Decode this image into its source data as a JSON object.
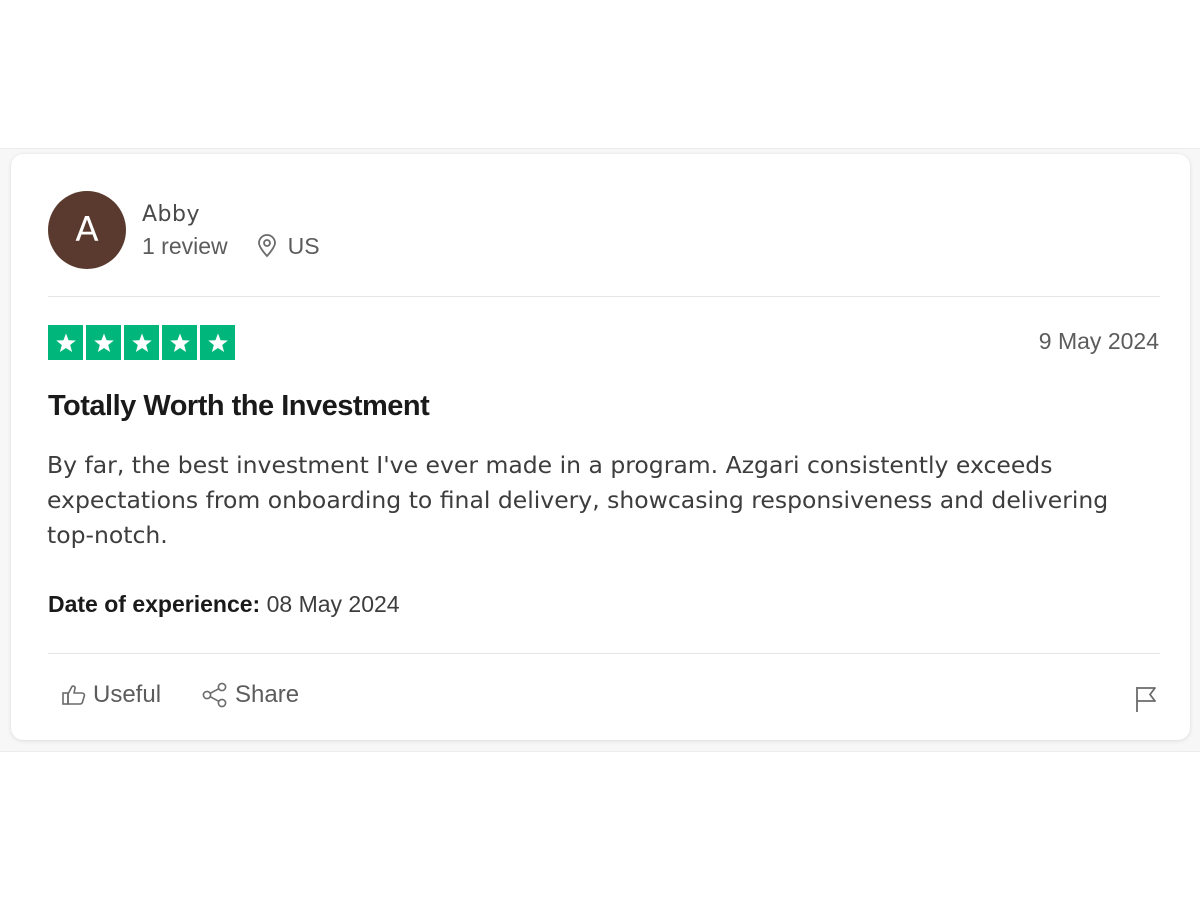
{
  "colors": {
    "avatar_bg": "#5a3a2e",
    "star_green": "#00b67a",
    "star_white": "#ffffff"
  },
  "reviewer": {
    "initial": "A",
    "name": "Abby",
    "review_count": "1 review",
    "location_icon": "location-pin-icon",
    "country": "US"
  },
  "review": {
    "rating": 5,
    "rating_max": 5,
    "date": "9 May 2024",
    "title": "Totally Worth the Investment",
    "body": "By far, the best investment I've ever made in a program. Azgari consistently exceeds expectations from onboarding to final delivery, showcasing responsiveness and delivering top-notch.",
    "experience_label": "Date of experience:",
    "experience_date": " 08 May 2024"
  },
  "actions": {
    "useful_icon": "thumbs-up-icon",
    "useful_label": "Useful",
    "share_icon": "share-icon",
    "share_label": "Share",
    "report_icon": "flag-icon"
  }
}
